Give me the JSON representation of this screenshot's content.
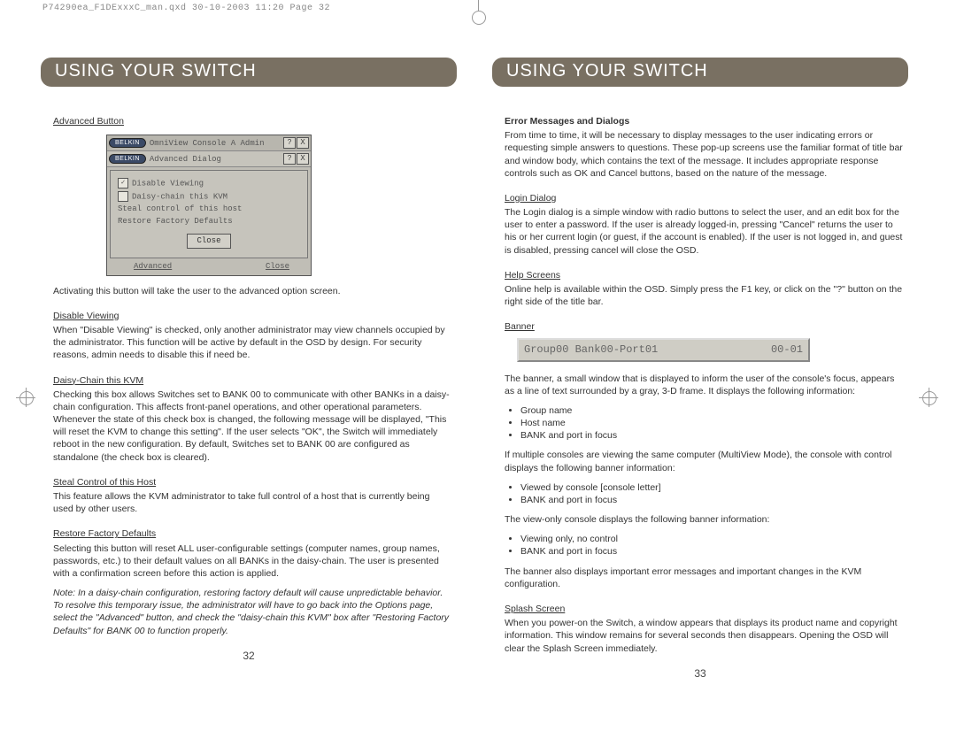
{
  "meta": {
    "line": "P74290ea_F1DExxxC_man.qxd  30-10-2003  11:20  Page 32"
  },
  "left": {
    "header": "USING YOUR SWITCH",
    "advanced_button": "Advanced Button",
    "dialog": {
      "titlebar_text": "OmniView       Console A Admin",
      "logo": "BELKIN",
      "help_icon": "?",
      "close_icon": "X",
      "inner_title": "Advanced Dialog",
      "cb1_checked": "✓",
      "opt_disable": "Disable Viewing",
      "opt_daisy": "Daisy-chain this KVM",
      "opt_steal": "Steal control of this host",
      "opt_restore": "Restore Factory Defaults",
      "btn_close": "Close",
      "link_advanced": "Advanced",
      "link_close": "Close"
    },
    "p1": "Activating this button will take the user to the advanced option screen.",
    "h_disable": "Disable Viewing",
    "p_disable": "When \"Disable Viewing\" is checked, only another administrator may view channels occupied by the administrator. This function will be active by default in the OSD by design. For security reasons, admin needs to disable this if need be.",
    "h_daisy": "Daisy-Chain this KVM",
    "p_daisy": "Checking this box allows Switches set to BANK 00 to communicate with other BANKs in a daisy-chain configuration. This affects front-panel operations, and other operational parameters. Whenever the state of this check box is changed, the following message will be displayed, \"This will reset the KVM to change this setting\". If the user selects \"OK\", the Switch will immediately reboot in the new configuration. By default, Switches set to BANK 00 are configured as standalone (the check box is cleared).",
    "h_steal": "Steal Control of this Host",
    "p_steal": "This feature allows the KVM administrator to take full control of a host that is currently being used by other users.",
    "h_restore": "Restore Factory Defaults",
    "p_restore": "Selecting this button will reset ALL user-configurable settings (computer names, group names, passwords, etc.) to their default values on all BANKs in the daisy-chain. The user is presented with a confirmation screen before this action is applied.",
    "note": "Note: In a daisy-chain configuration, restoring factory default will cause unpredictable behavior. To resolve this temporary issue, the administrator will have to go back into the Options page, select the \"Advanced\" button, and check the \"daisy-chain this KVM\" box after \"Restoring Factory Defaults\" for BANK 00 to function properly.",
    "page_num": "32"
  },
  "right": {
    "header": "USING YOUR SWITCH",
    "h_errors": "Error Messages and Dialogs",
    "p_errors": "From time to time, it will be necessary to display messages to the user indicating errors or requesting simple answers to questions. These pop-up screens use the familiar format of title bar and window body, which contains the text of the message. It includes appropriate response controls such as OK and Cancel buttons, based on the nature of the message.",
    "h_login": "Login Dialog",
    "p_login": "The Login dialog is a simple window with radio buttons to select the user, and an edit box for the user to enter a password. If the user is already logged-in, pressing \"Cancel\" returns the user to his or her current login (or guest, if the account is enabled). If the user is not logged in, and guest is disabled, pressing cancel will close the OSD.",
    "h_help": "Help Screens",
    "p_help": "Online help is available within the OSD. Simply press the F1 key, or click on the \"?\" button on the right side of the title bar.",
    "h_banner": "Banner",
    "banner_left": "Group00  Bank00-Port01",
    "banner_right": "00-01",
    "p_banner1": "The banner, a small window that is displayed to inform the user of the console's focus, appears as a line of text surrounded by a gray, 3-D frame. It displays the following information:",
    "bul1a": "Group name",
    "bul1b": "Host name",
    "bul1c": "BANK and port in focus",
    "p_banner2": "If multiple consoles are viewing the same computer (MultiView Mode), the console with control displays the following banner information:",
    "bul2a": "Viewed by console [console letter]",
    "bul2b": "BANK and port in focus",
    "p_banner3": "The view-only console displays the following banner information:",
    "bul3a": "Viewing only, no control",
    "bul3b": "BANK and port in focus",
    "p_banner4": "The banner also displays important error messages and important changes in the KVM configuration.",
    "h_splash": "Splash Screen",
    "p_splash": "When you power-on the Switch, a window appears that displays its product name and copyright information. This window remains for several seconds then disappears. Opening the OSD will clear the Splash Screen immediately.",
    "page_num": "33"
  }
}
